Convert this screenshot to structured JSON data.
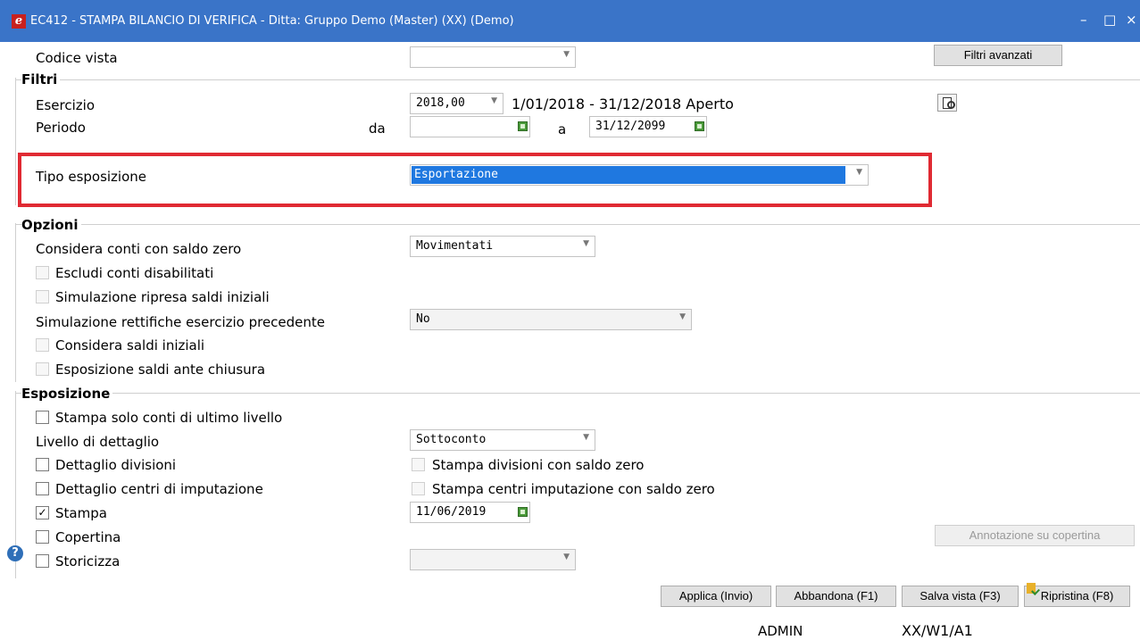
{
  "window": {
    "title": "EC412 - STAMPA BILANCIO DI VERIFICA - Ditta: Gruppo Demo (Master) (XX)  (Demo)",
    "minimize": "–",
    "maximize": "□",
    "close": "×"
  },
  "header": {
    "codice_vista_label": "Codice vista",
    "codice_vista_value": "",
    "filtri_avanzati": "Filtri avanzati"
  },
  "filtri": {
    "section": "Filtri",
    "esercizio_label": "Esercizio",
    "esercizio_value": "2018,00",
    "esercizio_info": "1/01/2018 - 31/12/2018 Aperto",
    "periodo_label": "Periodo",
    "da_label": "da",
    "da_value": "",
    "a_label": "a",
    "a_value": "31/12/2099",
    "tipo_label": "Tipo esposizione",
    "tipo_value": "Esportazione"
  },
  "opzioni": {
    "section": "Opzioni",
    "saldo_zero_label": "Considera conti con saldo zero",
    "saldo_zero_value": "Movimentati",
    "escludi_disabilitati": "Escludi conti disabilitati",
    "simulazione_ripresa": "Simulazione ripresa saldi iniziali",
    "rettifiche_label": "Simulazione rettifiche esercizio precedente",
    "rettifiche_value": "No",
    "considera_saldi_iniziali": "Considera saldi iniziali",
    "saldi_ante_chiusura": "Esposizione saldi ante chiusura"
  },
  "esposizione": {
    "section": "Esposizione",
    "ultimo_livello": "Stampa solo conti di ultimo livello",
    "livello_label": "Livello di dettaglio",
    "livello_value": "Sottoconto",
    "dettaglio_divisioni": "Dettaglio divisioni",
    "stampa_divisioni_zero": "Stampa divisioni con saldo zero",
    "dettaglio_centri": "Dettaglio centri di imputazione",
    "stampa_centri_zero": "Stampa centri imputazione con saldo zero",
    "stampa": "Stampa",
    "stampa_check": "✓",
    "stampa_date": "11/06/2019",
    "copertina": "Copertina",
    "annotazione": "Annotazione su copertina",
    "storicizza": "Storicizza",
    "storicizza_value": ""
  },
  "footer": {
    "help": "?",
    "applica": "Applica (Invio)",
    "abbandona": "Abbandona (F1)",
    "salva": "Salva vista (F3)",
    "ripristina": "Ripristina (F8)",
    "user": "ADMIN",
    "terminal": "XX/W1/A1"
  },
  "colors": {
    "titlebar": "#3a74c8",
    "highlight": "#e02a33",
    "selection": "#1f78e0"
  }
}
